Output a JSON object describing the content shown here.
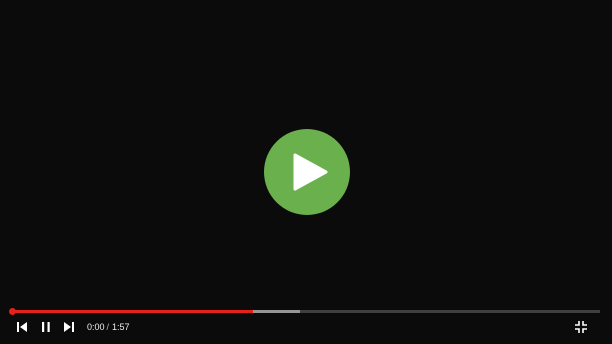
{
  "player": {
    "current_time": "0:00",
    "separator": "/",
    "duration": "1:57",
    "played_fraction": 0.41,
    "buffered_fraction": 0.49
  },
  "colors": {
    "background": "#0b0b0b",
    "play_button": "#6ab04c",
    "progress_played": "#e62117",
    "controls": "#ffffff"
  },
  "icons": {
    "big_play": "play-icon",
    "prev": "skip-previous-icon",
    "pause": "pause-icon",
    "next": "skip-next-icon",
    "fullscreen": "exit-fullscreen-icon"
  }
}
